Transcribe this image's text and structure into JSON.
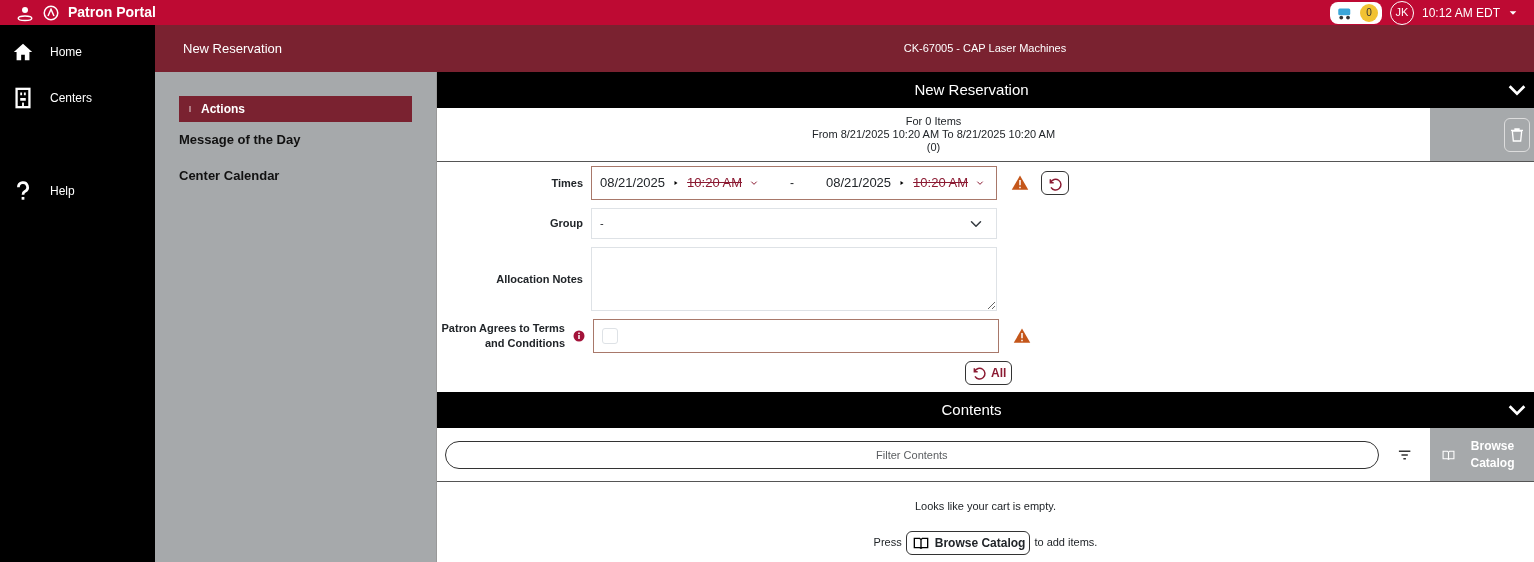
{
  "topbar": {
    "title": "Patron Portal",
    "cart_count": "0",
    "avatar": "JK",
    "time": "10:12 AM EDT"
  },
  "nav": [
    {
      "kind": "home",
      "label": "Home"
    },
    {
      "kind": "building",
      "label": "Centers"
    },
    {
      "kind": "help",
      "label": "Help"
    }
  ],
  "page_header": {
    "title": "New Reservation",
    "center": "CK-67005 - CAP Laser Machines"
  },
  "sidebar": {
    "actions_label": "Actions",
    "links": [
      "Message of the Day",
      "Center Calendar"
    ]
  },
  "reservation": {
    "title": "New Reservation",
    "summary": [
      "For 0 Items",
      "From 8/21/2025 10:20 AM To 8/21/2025 10:20 AM",
      "(0)"
    ],
    "times": {
      "label": "Times",
      "start_date": "08/21/2025",
      "start_time": "10:20 AM",
      "end_date": "08/21/2025",
      "end_time": "10:20 AM",
      "separator": "-",
      "time_invalid": true,
      "warning": true
    },
    "group": {
      "label": "Group",
      "value": "-"
    },
    "notes": {
      "label": "Allocation Notes"
    },
    "terms": {
      "label": "Patron Agrees to Terms and Conditions",
      "checked": false,
      "warning": true
    },
    "reset_all": "All"
  },
  "contents": {
    "title": "Contents",
    "filter_placeholder": "Filter Contents",
    "browse_label": "Browse Catalog",
    "empty_text": "Looks like your cart is empty.",
    "press_text": "Press",
    "inline_button": "Browse Catalog",
    "after_text": "to add items."
  }
}
